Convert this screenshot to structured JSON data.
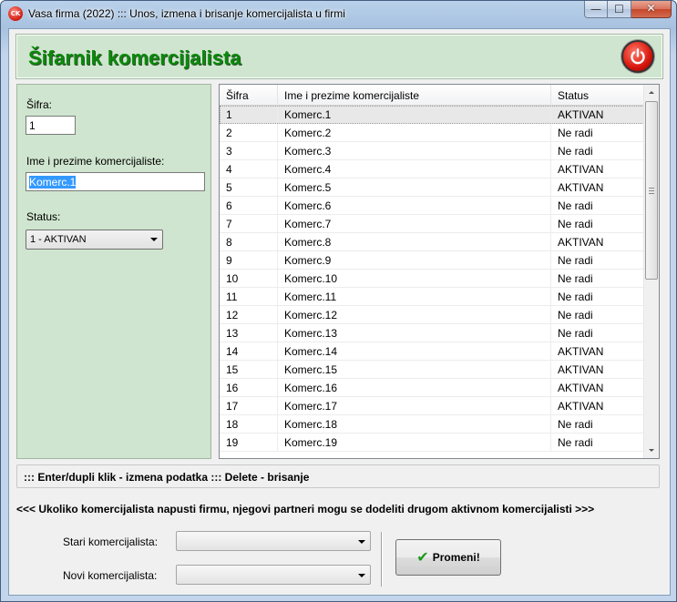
{
  "window": {
    "title": "Vasa firma (2022) ::: Unos, izmena i brisanje komercijalista u firmi",
    "app_icon_text": "CK",
    "controls": {
      "minimize": "—",
      "maximize": "☐",
      "close": "✕"
    }
  },
  "header": {
    "title": "Šifarnik komercijalista",
    "power_icon": "power-icon"
  },
  "form": {
    "sifra_label": "Šifra:",
    "sifra_value": "1",
    "name_label": "Ime i prezime komercijaliste:",
    "name_value": "Komerc.1",
    "status_label": "Status:",
    "status_value": "1 - AKTIVAN"
  },
  "grid": {
    "columns": [
      "Šifra",
      "Ime i prezime komercijaliste",
      "Status"
    ],
    "rows": [
      [
        "1",
        "Komerc.1",
        "AKTIVAN"
      ],
      [
        "2",
        "Komerc.2",
        "Ne radi"
      ],
      [
        "3",
        "Komerc.3",
        "Ne radi"
      ],
      [
        "4",
        "Komerc.4",
        "AKTIVAN"
      ],
      [
        "5",
        "Komerc.5",
        "AKTIVAN"
      ],
      [
        "6",
        "Komerc.6",
        "Ne radi"
      ],
      [
        "7",
        "Komerc.7",
        "Ne radi"
      ],
      [
        "8",
        "Komerc.8",
        "AKTIVAN"
      ],
      [
        "9",
        "Komerc.9",
        "Ne radi"
      ],
      [
        "10",
        "Komerc.10",
        "Ne radi"
      ],
      [
        "11",
        "Komerc.11",
        "Ne radi"
      ],
      [
        "12",
        "Komerc.12",
        "Ne radi"
      ],
      [
        "13",
        "Komerc.13",
        "Ne radi"
      ],
      [
        "14",
        "Komerc.14",
        "AKTIVAN"
      ],
      [
        "15",
        "Komerc.15",
        "AKTIVAN"
      ],
      [
        "16",
        "Komerc.16",
        "AKTIVAN"
      ],
      [
        "17",
        "Komerc.17",
        "AKTIVAN"
      ],
      [
        "18",
        "Komerc.18",
        "Ne radi"
      ],
      [
        "19",
        "Komerc.19",
        "Ne radi"
      ]
    ],
    "selected_index": 0
  },
  "hint": "::: Enter/dupli klik - izmena podatka ::: Delete - brisanje",
  "notice": "<<< Ukoliko komercijalista napusti firmu, njegovi partneri mogu se dodeliti drugom aktivnom komercijalisti >>>",
  "transfer": {
    "old_label": "Stari komercijalista:",
    "old_value": "",
    "new_label": "Novi komercijalista:",
    "new_value": "",
    "apply_label": "Promeni!",
    "apply_icon": "check-icon"
  },
  "colors": {
    "panel_green": "#cfe5cf",
    "title_green": "#0a8a0a",
    "selection_blue": "#3399ff"
  }
}
